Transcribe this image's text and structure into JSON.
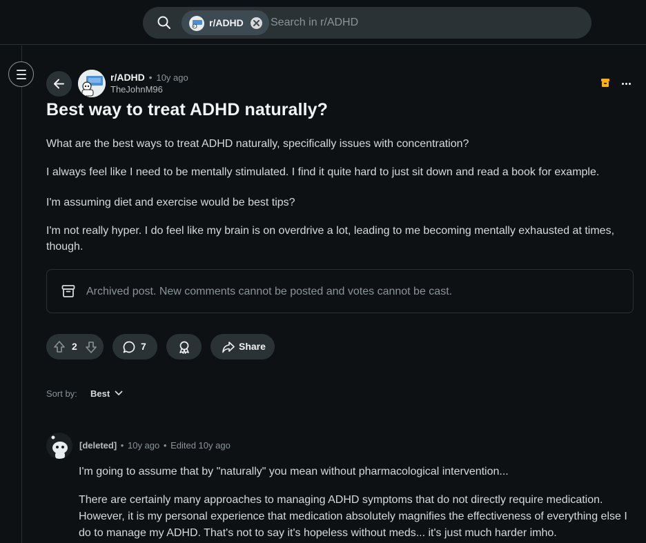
{
  "search": {
    "community_chip": "r/ADHD",
    "placeholder": "Search in r/ADHD"
  },
  "post": {
    "subreddit": "r/ADHD",
    "age": "10y ago",
    "author": "TheJohnM96",
    "title": "Best way to treat ADHD naturally?",
    "paragraphs": [
      "What are the best ways to treat ADHD naturally, specifically issues with concentration?",
      "I always feel like I need to be mentally stimulated. I find it quite hard to just sit down and read a book for example.",
      "I'm assuming diet and exercise would be best tips?",
      "I'm not really hyper. I do feel like my brain is on overdrive a lot, leading to me becoming mentally exhausted at times, though."
    ],
    "archived_notice": "Archived post. New comments cannot be posted and votes cannot be cast.",
    "votes": "2",
    "comment_count": "7",
    "share_label": "Share"
  },
  "sort": {
    "label": "Sort by:",
    "value": "Best"
  },
  "comment": {
    "author": "[deleted]",
    "age": "10y ago",
    "edited": "Edited 10y ago",
    "paragraphs": [
      "I'm going to assume that by \"naturally\" you mean without pharmacological intervention...",
      "There are certainly many approaches to managing ADHD symptoms that do not directly require medication. However, it is my personal experience that medication absolutely magnifies the effectiveness of everything else I do to manage my ADHD. That's not to say it's hopeless without meds... it's just much harder imho."
    ]
  },
  "icons": [
    "search-icon",
    "clear-icon",
    "menu-icon",
    "back-arrow-icon",
    "archive-icon",
    "overflow-icon",
    "upvote-icon",
    "downvote-icon",
    "comment-icon",
    "award-icon",
    "share-icon",
    "chevron-down-icon"
  ],
  "colors": {
    "background": "#0e1113",
    "surface": "#2a3236",
    "text": "#d7dadc",
    "muted": "#8a9499",
    "archive_badge": "#ffb000"
  }
}
